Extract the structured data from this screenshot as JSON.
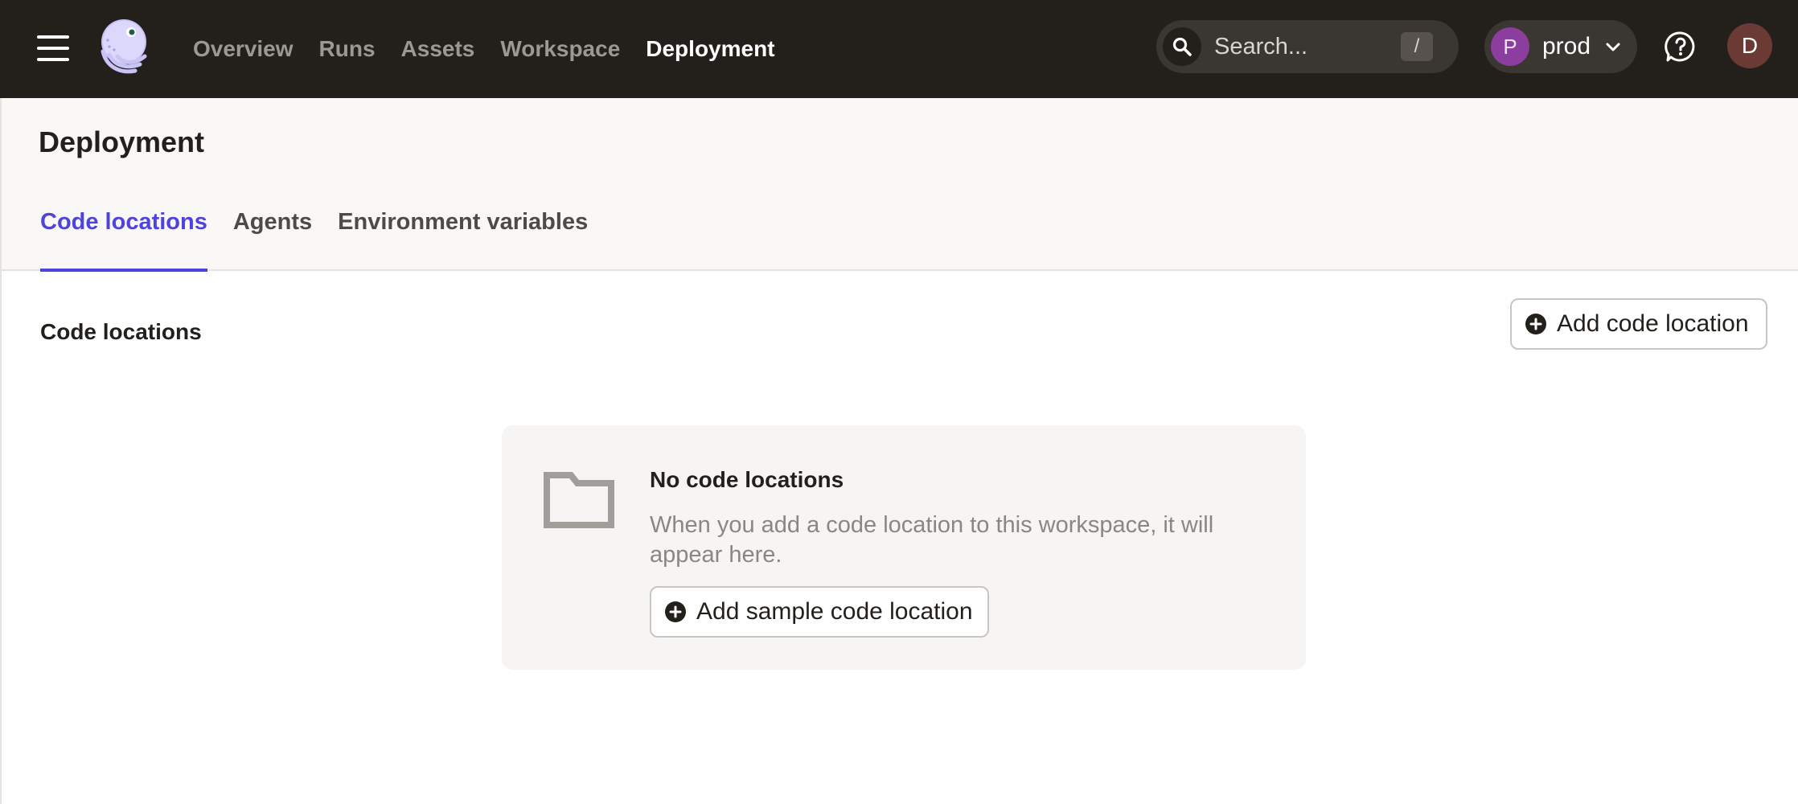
{
  "nav": {
    "links": [
      {
        "label": "Overview",
        "active": false
      },
      {
        "label": "Runs",
        "active": false
      },
      {
        "label": "Assets",
        "active": false
      },
      {
        "label": "Workspace",
        "active": false
      },
      {
        "label": "Deployment",
        "active": true
      }
    ],
    "search": {
      "placeholder": "Search...",
      "shortcut": "/"
    },
    "environment": {
      "initial": "P",
      "name": "prod",
      "color": "#8b3e9e"
    },
    "user": {
      "initial": "D",
      "color": "#6b3a35"
    }
  },
  "page": {
    "title": "Deployment",
    "tabs": [
      {
        "label": "Code locations",
        "active": true
      },
      {
        "label": "Agents",
        "active": false
      },
      {
        "label": "Environment variables",
        "active": false
      }
    ]
  },
  "main": {
    "section_title": "Code locations",
    "add_button_label": "Add code location",
    "empty_state": {
      "title": "No code locations",
      "description": "When you add a code location to this workspace, it will appear here.",
      "button_label": "Add sample code location"
    }
  },
  "colors": {
    "nav_bg": "#231f1b",
    "accent": "#4f43dd",
    "header_bg": "#f9f8f6",
    "card_bg": "#f6f5f3"
  }
}
